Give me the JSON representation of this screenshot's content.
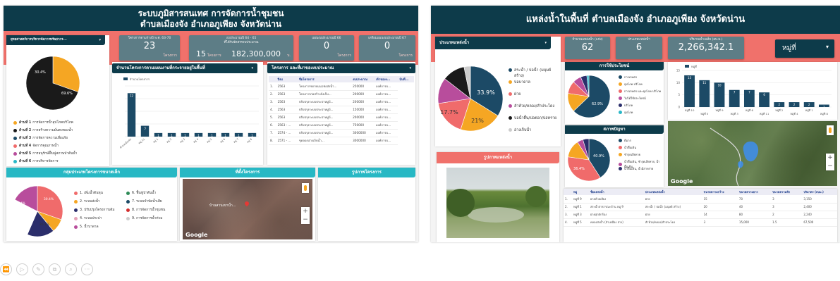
{
  "dashboard1": {
    "title_line1": "ระบบภูมิสารสนเทศ การจัดการน้ำชุมชน",
    "title_line2": "ตำบลเมืองจัง อำเภอภูเพียง จังหวัดน่าน",
    "filter_label": "ยุทธศาสตร์การบริหารจัดการทรัพยากร...",
    "kpis": [
      {
        "label": "โครงการตามร่างปี พ.ศ. 63-70",
        "value": "23",
        "unit": "โครงการ"
      },
      {
        "label": "งบประมาณปี 64 - 65",
        "label2": "ที่ได้รับจัดสรรงบประมาณ",
        "value": "15",
        "unit_mid": "โครงการ",
        "value2": "182,300,000",
        "unit": "บ."
      },
      {
        "label": "แผนงบประมาณปี 66",
        "value": "0",
        "unit": "โครงการ"
      },
      {
        "label": "เตรียมแผนงบประมาณปี 67",
        "value": "0",
        "unit": "โครงการ"
      }
    ],
    "pie_labels": [
      "30.4%",
      "69.6%"
    ],
    "strategies": [
      {
        "bold": "ด้านที่ 1",
        "text": "การจัดการน้ำอุปโภคบริโภค",
        "color": "#f5a623"
      },
      {
        "bold": "ด้านที่ 2",
        "text": "การสร้างความมั่นคงของน้ำ",
        "color": "#1a1a1a"
      },
      {
        "bold": "ด้านที่ 3",
        "text": "การจัดการความเสี่ยงภัย",
        "color": "#1c4a66"
      },
      {
        "bold": "ด้านที่ 4",
        "text": "จัดการคุณภาพน้ำ",
        "color": "#f06b6b"
      },
      {
        "bold": "ด้านที่ 5",
        "text": "การอนุรักษ์ฟื้นฟูสภาพป่าต้นน้ำ",
        "color": "#b84d9c"
      },
      {
        "bold": "ด้านที่ 6",
        "text": "การบริหารจัดการ",
        "color": "#29b7c7"
      }
    ],
    "bar_panel_title": "จำนวนโครงการตามแผนงานที่กระจายอยู่ในพื้นที่",
    "bar_legend": "จำนวนโครงการ",
    "table_panel_title": "โครงการ และที่มาของงบประมาณ",
    "table_headers": [
      "ปีงบ",
      "ชื่อโครงการ",
      "งบประมาณ",
      "เจ้าของง...",
      "บันทึ..."
    ],
    "table_rows": [
      [
        "1.",
        "2563",
        "โครงการขยายแนวท่อส่งน้ำ...",
        "250000",
        "องค์การบ..."
      ],
      [
        "2.",
        "2563",
        "โครงการก่อสร้างถังเก็บ...",
        "200000",
        "องค์การบ..."
      ],
      [
        "3.",
        "2563",
        "ปรับปรุงระบบประปาหมู่บ้...",
        "200000",
        "องค์การบ..."
      ],
      [
        "4.",
        "2563",
        "ปรับปรุงระบบประปาหมู่บ้...",
        "150000",
        "องค์การบ..."
      ],
      [
        "5.",
        "2563",
        "ปรับปรุงระบบประปาหมู่บ้...",
        "200000",
        "องค์การบ..."
      ],
      [
        "6.",
        "2563 - ...",
        "ปรับปรุงระบบประปาหมู่บ้...",
        "750000",
        "องค์การบ..."
      ],
      [
        "7.",
        "2574 - ...",
        "ปรับปรุงระบบประปาหมู่บ้...",
        "3000000",
        "องค์การบ..."
      ],
      [
        "8.",
        "2571 - ...",
        "ขุดลอกอ่างเก็บน้ำ...",
        "3000000",
        "องค์การบ..."
      ]
    ],
    "small_projects_title": "กลุ่มประเภทโครงการขนาดเล็ก",
    "small_pie_labels": [
      "30.4%",
      "17.4%",
      "17.4%",
      "26.1%"
    ],
    "small_legend": [
      {
        "text": "1. เพิ่มน้ำต้นทุน",
        "color": "#f06b6b"
      },
      {
        "text": "2. ระบบส่งน้ำ",
        "color": "#f5a623"
      },
      {
        "text": "3. ปรับปรุงโครงการเดิม",
        "color": "#2b2e6b"
      },
      {
        "text": "4. ระบบประปา",
        "color": "#e5a3b8"
      },
      {
        "text": "5. น้ำบาดาล",
        "color": "#b84d9c"
      },
      {
        "text": "6. ฟื้นฟูป่าต้นน้ำ",
        "color": "#2e8b57"
      },
      {
        "text": "7. ระบบบำบัดน้ำเสีย",
        "color": "#1c4a66"
      },
      {
        "text": "8. การจัดการน้ำชุมชน",
        "color": "#d32f2f"
      },
      {
        "text": "9. การจัดการน้ำท่วม",
        "color": "#cccccc"
      }
    ],
    "location_title": "ที่ตั้งโครงการ",
    "map_label": "บ้านสวนเขาน้ำ...",
    "photos_title": "รูปภาพโครงการ",
    "map_brand": "Google"
  },
  "dashboard2": {
    "title": "แหล่งน้ำในพื้นที่ ตำบลเมืองจัง อำเภอภูเพียง จังหวัดน่าน",
    "filter_label": "ประเภทแหล่งน้ำ",
    "kpis": [
      {
        "label": "จำนวนแหล่งน้ำ (แห่ง)",
        "value": "62"
      },
      {
        "label": "ประเภทแหล่งน้ำ",
        "value": "6"
      },
      {
        "label": "ปริมาณน้ำเฉลี่ย (ลบ.ม.)",
        "value": "2,266,342.1"
      }
    ],
    "village_filter": "หมู่ที่",
    "pie_labels": [
      "33.9%",
      "21%",
      "17.7%"
    ],
    "types_legend": [
      {
        "text": "สระน้ำ / บ่อน้ำ (มนุษย์สร้าง)",
        "color": "#1c4a66"
      },
      {
        "text": "บ่อบาดาล",
        "color": "#f5a623"
      },
      {
        "text": "ฝาย",
        "color": "#f06b6b"
      },
      {
        "text": "ลำห้วย/คลอง/ลำประโดง",
        "color": "#b84d9c"
      },
      {
        "text": "บ่อน้ำตื้น/บ่อตอก/บ่อทราย",
        "color": "#1a1a1a"
      },
      {
        "text": "อ่างเก็บน้ำ",
        "color": "#cccccc"
      }
    ],
    "usage_title": "การใช้ประโยชน์",
    "usage_pie_label": "62.9%",
    "usage_legend": [
      "การเกษตร",
      "อุปโภค บริโภค",
      "การเกษตร และอุปโภค บริโภค",
      "ไม่ได้ใช้ประโยชน์",
      "บริโภค",
      "อุปโภค"
    ],
    "problem_title": "สภาพปัญหา",
    "problem_pie_labels": [
      "40.9%",
      "36.4%"
    ],
    "problem_legend": [
      "ดีมาก",
      "น้ำตื้นเขิน",
      "ชำรุดเสียหาย",
      "น้ำตื้นเขิน, ชำรุดเสียหาย, น้ำตื้นเขิน",
      "น้ำตื้นเขิน, น้ำมีสาหร่าย"
    ],
    "bar_legend": "หมู่ที่",
    "photo_title": "รูปภาพแหล่งน้ำ",
    "map_brand": "Google",
    "table_headers": [
      "",
      "หมู่",
      "ชื่อแหล่งน้ำ",
      "ประเภทแหล่งน้ำ",
      "ขนาดความกว้าง",
      "ขนาดความยาว",
      "ขนาดความลึก",
      "ปริมาตร (ลบม.)"
    ],
    "table_rows": [
      [
        "1.",
        "หมู่ที่ 9",
        "ฝายห้วยเลียง",
        "ฝาย",
        "15",
        "70",
        "3",
        "3,150"
      ],
      [
        "2.",
        "หมู่ที่ 1",
        "สระน้ำสาธารณะบ้าน หมู่ 9",
        "สระน้ำ / บ่อน้ำ (มนุษย์ สร้าง)",
        "20",
        "40",
        "3",
        "2,400"
      ],
      [
        "3.",
        "หมู่ที่ 3",
        "ฝายสุกลักร้อง",
        "ฝาย",
        "14",
        "80",
        "2",
        "2,240"
      ],
      [
        "4.",
        "หมู่ที่ 5",
        "คลองส่งน้ำ (ลำเหมือง ล่าง)",
        "ลำห้วย/คลอง/ลำประโดง",
        "3",
        "15,000",
        "1.5",
        "67,500"
      ]
    ]
  },
  "toolbar": {
    "icons": [
      "rewind-icon",
      "play-icon",
      "pencil-icon",
      "copy-icon",
      "search-icon",
      "more-icon"
    ]
  },
  "chart_data": [
    {
      "type": "pie",
      "title": "",
      "labels": [
        "ด้านที่ 1",
        "ด้านที่ 2"
      ],
      "values": [
        30.4,
        69.6
      ],
      "colors": [
        "#f5a623",
        "#1a1a1a"
      ]
    },
    {
      "type": "bar",
      "title": "จำนวนโครงการตามแผนงานที่กระจายอยู่ในพื้นที่",
      "categories": [
        "ตำบลเมืองจัง",
        "หมู่ 11",
        "หมู่ 1",
        "หมู่ 2",
        "หมู่ 3",
        "หมู่ 4",
        "หมู่ 5",
        "หมู่ 6",
        "หมู่ 7",
        "หมู่ 8"
      ],
      "series": [
        {
          "name": "จำนวนโครงการ",
          "values": [
            12,
            3,
            1,
            1,
            1,
            1,
            1,
            1,
            1,
            1
          ]
        }
      ],
      "ylim": [
        0,
        14
      ],
      "color": "#1c4a66"
    },
    {
      "type": "pie",
      "title": "กลุ่มประเภทโครงการขนาดเล็ก",
      "labels": [
        "1",
        "2",
        "3",
        "4",
        "5"
      ],
      "values": [
        30.4,
        8.7,
        17.4,
        26.1,
        17.4
      ],
      "colors": [
        "#f06b6b",
        "#f5a623",
        "#2b2e6b",
        "#ffffff",
        "#b84d9c"
      ]
    },
    {
      "type": "pie",
      "title": "ประเภทแหล่งน้ำ",
      "labels": [
        "สระน้ำ / บ่อน้ำ (มนุษย์สร้าง)",
        "บ่อบาดาล",
        "ฝาย",
        "ลำห้วย/คลอง/ลำประโดง",
        "บ่อน้ำตื้น/บ่อตอก/บ่อทราย",
        "อ่างเก็บน้ำ"
      ],
      "values": [
        33.9,
        21,
        17.7,
        12.9,
        11.3,
        3.2
      ],
      "colors": [
        "#1c4a66",
        "#f5a623",
        "#f06b6b",
        "#b84d9c",
        "#1a1a1a",
        "#cccccc"
      ]
    },
    {
      "type": "pie",
      "title": "การใช้ประโยชน์",
      "values": [
        62.9,
        14.5,
        9.7,
        6.5,
        4.8,
        1.6
      ],
      "colors": [
        "#1c4a66",
        "#f5a623",
        "#f06b6b",
        "#b84d9c",
        "#2b2e6b",
        "#29b7c7"
      ]
    },
    {
      "type": "pie",
      "title": "สภาพปัญหา",
      "values": [
        40.9,
        36.4,
        13.6,
        4.5,
        4.6
      ],
      "colors": [
        "#1c4a66",
        "#f06b6b",
        "#f5a623",
        "#b84d9c",
        "#2b2e6b"
      ]
    },
    {
      "type": "bar",
      "title": "",
      "categories": [
        "หมู่ที่ 10",
        "หมู่ที่ 5",
        "หมู่ที่ 9",
        "หมู่ที่ 3",
        "หมู่ที่ 6",
        "หมู่ที่ 11",
        "หมู่ที่ 2",
        "หมู่ที่ 4",
        "หมู่ที่ 1",
        "หมู่ที่ 8"
      ],
      "series": [
        {
          "name": "หมู่ที่",
          "values": [
            13,
            11,
            10,
            7,
            7,
            6,
            2,
            2,
            2,
            1
          ]
        }
      ],
      "ylim": [
        0,
        15
      ],
      "color": "#1c4a66"
    }
  ]
}
